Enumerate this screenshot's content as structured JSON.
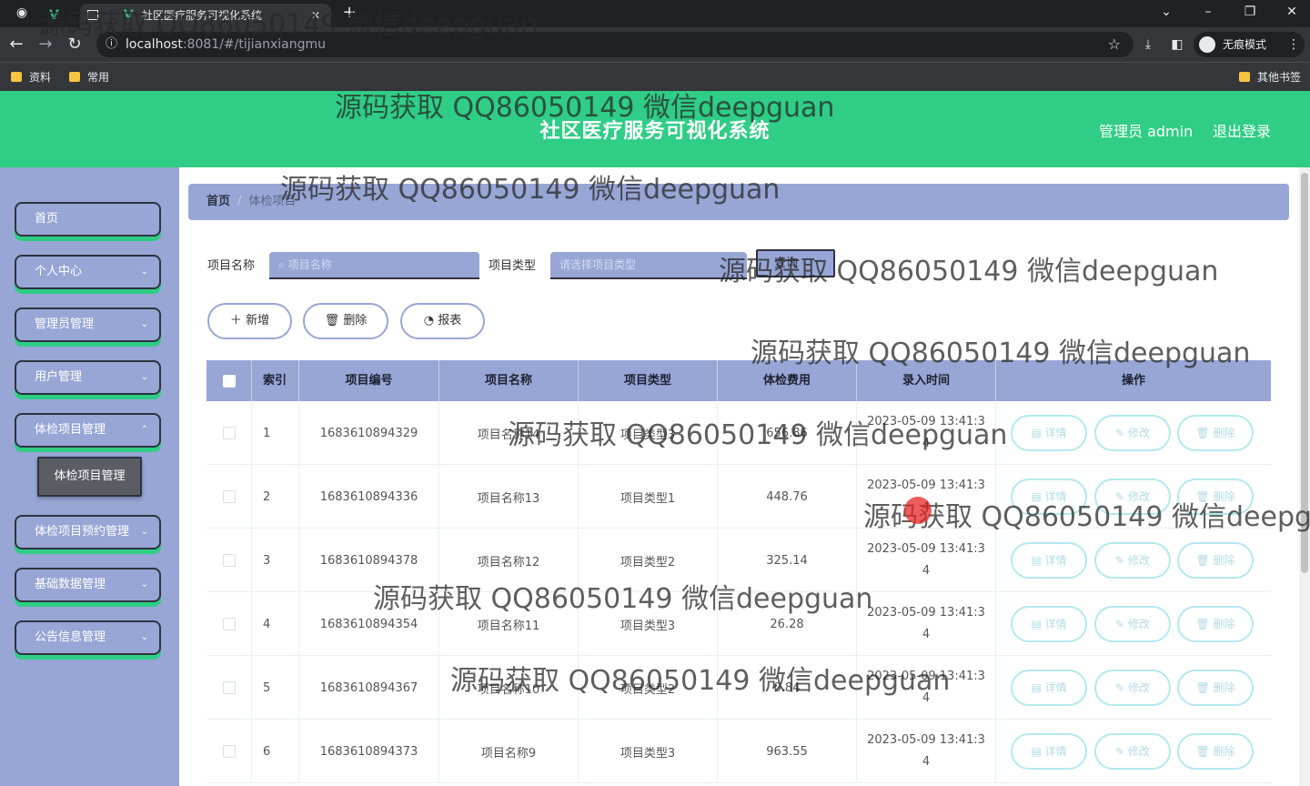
{
  "browser": {
    "tab_title": "社区医疗服务可视化系统",
    "url_host": "localhost",
    "url_rest": ":8081/#/tijianxiangmu",
    "incognito_label": "无痕模式",
    "bookmarks": [
      "资料",
      "常用"
    ],
    "other_bookmarks": "其他书签"
  },
  "header": {
    "title": "社区医疗服务可视化系统",
    "admin_label": "管理员 admin",
    "logout_label": "退出登录"
  },
  "sidebar": {
    "items": [
      {
        "label": "首页"
      },
      {
        "label": "个人中心"
      },
      {
        "label": "管理员管理"
      },
      {
        "label": "用户管理"
      },
      {
        "label": "体检项目管理"
      },
      {
        "label": "体检项目预约管理"
      },
      {
        "label": "基础数据管理"
      },
      {
        "label": "公告信息管理"
      }
    ],
    "active_sub": "体检项目管理"
  },
  "breadcrumb": {
    "home": "首页",
    "sep": "/",
    "current": "体检项目"
  },
  "search": {
    "name_label": "项目名称",
    "name_placeholder": "项目名称",
    "type_label": "项目类型",
    "type_placeholder": "请选择项目类型",
    "query_label": "查询"
  },
  "actions": {
    "add": "新增",
    "delete": "删除",
    "report": "报表"
  },
  "table": {
    "headers": [
      "索引",
      "项目编号",
      "项目名称",
      "项目类型",
      "体检费用",
      "录入时间",
      "操作"
    ],
    "ops": {
      "detail": "详情",
      "edit": "修改",
      "delete": "删除"
    },
    "rows": [
      {
        "index": "1",
        "code": "1683610894329",
        "name": "项目名称14",
        "type": "项目类型3",
        "fee": "656.86",
        "time": "2023-05-09 13:41:34"
      },
      {
        "index": "2",
        "code": "1683610894336",
        "name": "项目名称13",
        "type": "项目类型1",
        "fee": "448.76",
        "time": "2023-05-09 13:41:34"
      },
      {
        "index": "3",
        "code": "1683610894378",
        "name": "项目名称12",
        "type": "项目类型2",
        "fee": "325.14",
        "time": "2023-05-09 13:41:34"
      },
      {
        "index": "4",
        "code": "1683610894354",
        "name": "项目名称11",
        "type": "项目类型3",
        "fee": "26.28",
        "time": "2023-05-09 13:41:34"
      },
      {
        "index": "5",
        "code": "1683610894367",
        "name": "项目名称10",
        "type": "项目类型2",
        "fee": "0.84",
        "time": "2023-05-09 13:41:34"
      },
      {
        "index": "6",
        "code": "1683610894373",
        "name": "项目名称9",
        "type": "项目类型3",
        "fee": "963.55",
        "time": "2023-05-09 13:41:34"
      }
    ]
  },
  "watermark": "源码获取 QQ86050149 微信deepguan",
  "colors": {
    "header": "#2fcd85",
    "sidebar": "#98a6d6",
    "dark": "#2d3340"
  }
}
